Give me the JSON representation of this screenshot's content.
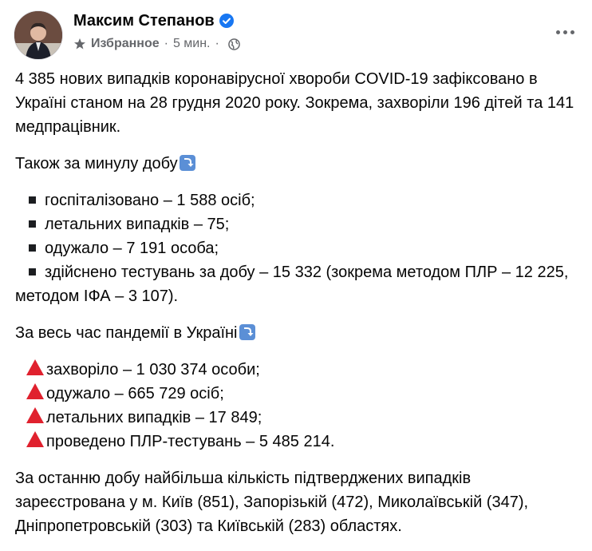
{
  "post": {
    "author": "Максим Степанов",
    "category": "Избранное",
    "time": "5 мин.",
    "separator": "·",
    "icons": {
      "verified": "verified-badge-icon",
      "star": "star-icon",
      "globe": "globe-icon",
      "more": "more-options-icon",
      "arrow": "arrow-down-box-icon",
      "triangle": "red-triangle-icon"
    },
    "colors": {
      "verified": "#1877f2",
      "triangle": "#e0212e",
      "meta": "#65676b"
    },
    "paragraph1": "4 385 нових випадків коронавірусної хвороби COVID-19 зафіксовано в Україні станом на 28 грудня 2020 року. Зокрема, захворіли 196 дітей та 141 медпрацівник.",
    "daily_heading": "Також за минулу добу",
    "daily_items": [
      "госпіталізовано – 1 588 осіб;",
      "летальних випадків – 75;",
      "одужало – 7 191 особа;",
      "здійснено тестувань за добу – 15 332 (зокрема методом ПЛР – 12 225, методом ІФА – 3 107)."
    ],
    "total_heading": "За весь час пандемії в Україні",
    "total_items": [
      "захворіло – 1 030 374 особи;",
      "одужало – 665 729 осіб;",
      "летальних випадків – 17 849;",
      "проведено ПЛР-тестувань – 5 485 214."
    ],
    "paragraph_last": "За останню добу найбільша кількість підтверджених випадків зареєстрована у м. Київ (851), Запорізькій (472), Миколаївській (347), Дніпропетровській (303) та Київській (283) областях."
  }
}
